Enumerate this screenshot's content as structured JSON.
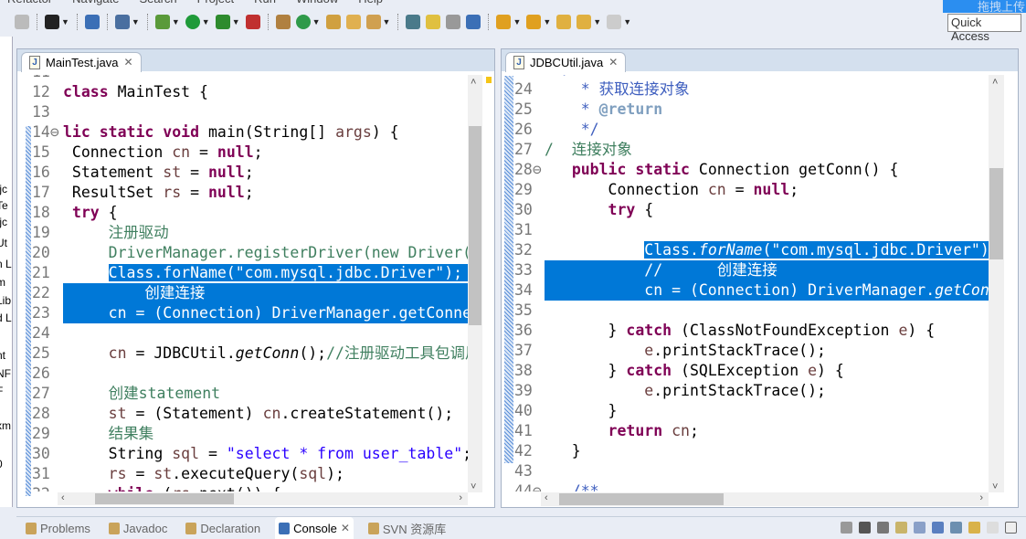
{
  "menu": [
    "Refactor",
    "Navigate",
    "Search",
    "Project",
    "Run",
    "Window",
    "Help"
  ],
  "quick_access": {
    "label": "Quick Access",
    "upload_label": "拖拽上传"
  },
  "left_strip": [
    ".jc",
    "Te",
    ".jc",
    "Ut",
    "n L",
    "m",
    "Lib",
    "d L",
    "nt",
    "NF",
    "F",
    "xm",
    "0"
  ],
  "toolbar_icons": [
    "save-icon",
    "person-icon",
    "monitor-icon",
    "skip-breakpoints-icon",
    "debug-icon",
    "run-icon",
    "coverage-icon",
    "external-tools-icon",
    "new-package-icon",
    "new-class-icon",
    "open-type-icon",
    "open-folder-icon",
    "search-icon",
    "toggle-mark-icon",
    "highlighter-icon",
    "annotation-icon",
    "show-whitespace-icon",
    "next-annotation-icon",
    "prev-annotation-icon",
    "last-edit-icon",
    "back-icon",
    "forward-icon"
  ],
  "colors": {
    "selection": "#0078d7",
    "keyword": "#7f0055",
    "comment": "#3f7f5f",
    "string": "#2a00ff",
    "javadoc": "#3f5fbf"
  },
  "left_editor": {
    "tab": "MainTest.java",
    "lines": [
      {
        "n": "11",
        "t": []
      },
      {
        "n": "12",
        "t": [
          [
            "class",
            "k"
          ],
          [
            " MainTest {",
            "p"
          ]
        ]
      },
      {
        "n": "13",
        "t": []
      },
      {
        "n": "14⊖",
        "t": [
          [
            "lic",
            "k"
          ],
          [
            " ",
            "p"
          ],
          [
            "static",
            "k"
          ],
          [
            " ",
            "p"
          ],
          [
            "void",
            "k"
          ],
          [
            " main(String[] ",
            "p"
          ],
          [
            "args",
            "v"
          ],
          [
            ") {",
            "p"
          ]
        ]
      },
      {
        "n": "15",
        "t": [
          [
            " Connection ",
            "p"
          ],
          [
            "cn",
            "v"
          ],
          [
            " = ",
            "p"
          ],
          [
            "null",
            "k"
          ],
          [
            ";",
            "p"
          ]
        ]
      },
      {
        "n": "16",
        "t": [
          [
            " Statement ",
            "p"
          ],
          [
            "st",
            "v"
          ],
          [
            " = ",
            "p"
          ],
          [
            "null",
            "k"
          ],
          [
            ";",
            "p"
          ]
        ]
      },
      {
        "n": "17",
        "t": [
          [
            " ResultSet ",
            "p"
          ],
          [
            "rs",
            "v"
          ],
          [
            " = ",
            "p"
          ],
          [
            "null",
            "k"
          ],
          [
            ";",
            "p"
          ]
        ]
      },
      {
        "n": "18",
        "t": [
          [
            " ",
            "p"
          ],
          [
            "try",
            "k"
          ],
          [
            " {",
            "p"
          ]
        ]
      },
      {
        "n": "19",
        "t": [
          [
            "     注册驱动",
            "c"
          ]
        ]
      },
      {
        "n": "20",
        "t": [
          [
            "     DriverManager.registerDriver(new Driver());",
            "c"
          ]
        ]
      },
      {
        "n": "21",
        "t": [
          [
            "     ",
            "p"
          ],
          [
            "Class.forName(\"com.mysql.jdbc.Driver\");  ",
            "p",
            1
          ]
        ]
      },
      {
        "n": "22",
        "full": true,
        "t": [
          [
            "         创建连接",
            "p",
            1
          ]
        ]
      },
      {
        "n": "23",
        "full": true,
        "t": [
          [
            "     cn = (Connection) DriverManager.getConnection(",
            "p",
            1
          ]
        ]
      },
      {
        "n": "24",
        "t": []
      },
      {
        "n": "25",
        "t": [
          [
            "     ",
            "p"
          ],
          [
            "cn",
            "v"
          ],
          [
            " = JDBCUtil.",
            "p"
          ],
          [
            "getConn",
            "pi"
          ],
          [
            "();",
            "p"
          ],
          [
            "//注册驱动工具包调用",
            "c"
          ]
        ]
      },
      {
        "n": "26",
        "t": []
      },
      {
        "n": "27",
        "t": [
          [
            "     创建statement",
            "c"
          ]
        ]
      },
      {
        "n": "28",
        "t": [
          [
            "     ",
            "p"
          ],
          [
            "st",
            "v"
          ],
          [
            " = (Statement) ",
            "p"
          ],
          [
            "cn",
            "v"
          ],
          [
            ".createStatement();",
            "p"
          ]
        ]
      },
      {
        "n": "29",
        "t": [
          [
            "     结果集",
            "c"
          ]
        ]
      },
      {
        "n": "30",
        "t": [
          [
            "     String ",
            "p"
          ],
          [
            "sql",
            "v"
          ],
          [
            " = ",
            "p"
          ],
          [
            "\"select * from user_table\"",
            "s"
          ],
          [
            ";",
            "p"
          ]
        ]
      },
      {
        "n": "31",
        "t": [
          [
            "     ",
            "p"
          ],
          [
            "rs",
            "v"
          ],
          [
            " = ",
            "p"
          ],
          [
            "st",
            "v"
          ],
          [
            ".executeQuery(",
            "p"
          ],
          [
            "sql",
            "v"
          ],
          [
            ");",
            "p"
          ]
        ]
      },
      {
        "n": "32",
        "t": [
          [
            "     ",
            "p"
          ],
          [
            "while",
            "k"
          ],
          [
            " (",
            "p"
          ],
          [
            "rs",
            "v"
          ],
          [
            ".next()) {",
            "p"
          ]
        ]
      }
    ]
  },
  "right_editor": {
    "tab": "JDBCUtil.java",
    "lines": [
      {
        "n": "23",
        "t": [
          [
            "  /",
            "j"
          ]
        ]
      },
      {
        "n": "24",
        "t": [
          [
            "    * 获取连接对象",
            "j"
          ]
        ]
      },
      {
        "n": "25",
        "t": [
          [
            "    * ",
            "j"
          ],
          [
            "@return",
            "t"
          ]
        ]
      },
      {
        "n": "26",
        "t": [
          [
            "    */",
            "j"
          ]
        ]
      },
      {
        "n": "27",
        "t": [
          [
            "/  连接对象",
            "c"
          ]
        ]
      },
      {
        "n": "28⊖",
        "t": [
          [
            "   ",
            "p"
          ],
          [
            "public",
            "k"
          ],
          [
            " ",
            "p"
          ],
          [
            "static",
            "k"
          ],
          [
            " Connection getConn() {",
            "p"
          ]
        ]
      },
      {
        "n": "29",
        "t": [
          [
            "       Connection ",
            "p"
          ],
          [
            "cn",
            "v"
          ],
          [
            " = ",
            "p"
          ],
          [
            "null",
            "k"
          ],
          [
            ";",
            "p"
          ]
        ]
      },
      {
        "n": "30",
        "t": [
          [
            "       ",
            "p"
          ],
          [
            "try",
            "k"
          ],
          [
            " {",
            "p"
          ]
        ]
      },
      {
        "n": "31",
        "t": []
      },
      {
        "n": "32",
        "t": [
          [
            "           ",
            "p"
          ],
          [
            "Class.",
            "p",
            1
          ],
          [
            "forName",
            "pi",
            1
          ],
          [
            "(\"com.mysql.jdbc.Driver\");",
            "p",
            1
          ]
        ]
      },
      {
        "n": "33",
        "full": true,
        "t": [
          [
            "           //      创建连接",
            "p",
            1
          ]
        ]
      },
      {
        "n": "34",
        "full": true,
        "t": [
          [
            "           cn = (Connection) DriverManager.",
            "p",
            1
          ],
          [
            "getConnection",
            "pi",
            1
          ]
        ]
      },
      {
        "n": "35",
        "t": []
      },
      {
        "n": "36",
        "t": [
          [
            "       } ",
            "p"
          ],
          [
            "catch",
            "k"
          ],
          [
            " (ClassNotFoundException ",
            "p"
          ],
          [
            "e",
            "v"
          ],
          [
            ") {",
            "p"
          ]
        ]
      },
      {
        "n": "37",
        "t": [
          [
            "           ",
            "p"
          ],
          [
            "e",
            "v"
          ],
          [
            ".printStackTrace();",
            "p"
          ]
        ]
      },
      {
        "n": "38",
        "t": [
          [
            "       } ",
            "p"
          ],
          [
            "catch",
            "k"
          ],
          [
            " (SQLException ",
            "p"
          ],
          [
            "e",
            "v"
          ],
          [
            ") {",
            "p"
          ]
        ]
      },
      {
        "n": "39",
        "t": [
          [
            "           ",
            "p"
          ],
          [
            "e",
            "v"
          ],
          [
            ".printStackTrace();",
            "p"
          ]
        ]
      },
      {
        "n": "40",
        "t": [
          [
            "       }",
            "p"
          ]
        ]
      },
      {
        "n": "41",
        "t": [
          [
            "       ",
            "p"
          ],
          [
            "return",
            "k"
          ],
          [
            " ",
            "p"
          ],
          [
            "cn",
            "v"
          ],
          [
            ";",
            "p"
          ]
        ]
      },
      {
        "n": "42",
        "t": [
          [
            "   }",
            "p"
          ]
        ]
      },
      {
        "n": "43",
        "t": []
      },
      {
        "n": "44⊖",
        "t": [
          [
            "   /**",
            "j"
          ]
        ]
      }
    ]
  },
  "bottom_tabs": [
    {
      "label": "Problems",
      "icon": "problems-icon"
    },
    {
      "label": "Javadoc",
      "icon": "at-icon"
    },
    {
      "label": "Declaration",
      "icon": "declaration-icon"
    },
    {
      "label": "Console",
      "icon": "console-icon",
      "active": true
    },
    {
      "label": "SVN 资源库",
      "icon": "svn-icon"
    }
  ]
}
